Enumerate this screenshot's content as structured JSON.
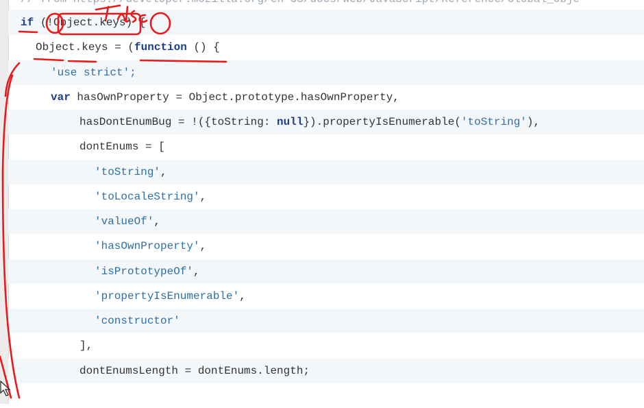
{
  "annotation": {
    "text": "false",
    "color": "#e8191a"
  },
  "code": {
    "comment_partial": "// from https://developer.mozilla.org/en-US/docs/Web/JavaScript/Reference/Global_Obje",
    "l1": {
      "kw": "if",
      "cond": "(!Object.keys)",
      "brace": " {"
    },
    "l2": {
      "lhs": "Object.keys = (",
      "kw": "function",
      "rest": " () {"
    },
    "l3": {
      "str": "'use strict';"
    },
    "l4": {
      "kw": "var",
      "rest": " hasOwnProperty = Object.prototype.hasOwnProperty,"
    },
    "l5": {
      "pre": "hasDontEnumBug = !({toString: ",
      "kw": "null",
      "mid": "}).propertyIsEnumerable(",
      "str": "'toString'",
      "post": "),"
    },
    "l6": {
      "text": "dontEnums = ["
    },
    "items": [
      {
        "str": "'toString'",
        "sep": ","
      },
      {
        "str": "'toLocaleString'",
        "sep": ","
      },
      {
        "str": "'valueOf'",
        "sep": ","
      },
      {
        "str": "'hasOwnProperty'",
        "sep": ","
      },
      {
        "str": "'isPrototypeOf'",
        "sep": ","
      },
      {
        "str": "'propertyIsEnumerable'",
        "sep": ","
      },
      {
        "str": "'constructor'",
        "sep": ""
      }
    ],
    "l14": {
      "text": "],"
    },
    "l15": {
      "text": "dontEnumsLength = dontEnums.length;"
    }
  }
}
